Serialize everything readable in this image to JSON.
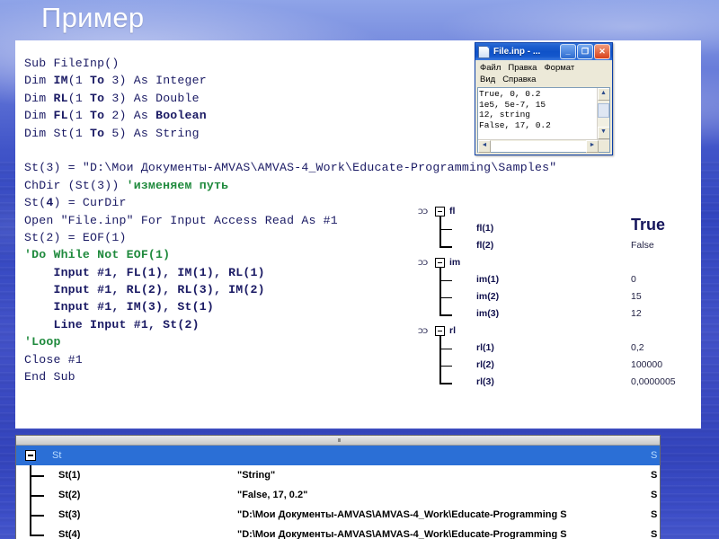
{
  "slide": {
    "title": "Пример"
  },
  "code": {
    "lines": [
      [
        {
          "t": "Sub ",
          "b": false
        },
        {
          "t": "FileInp",
          "b": false
        },
        {
          "t": "()",
          "b": false
        }
      ],
      [
        {
          "t": "Dim ",
          "b": false
        },
        {
          "t": "IM",
          "b": true
        },
        {
          "t": "(1 ",
          "b": false
        },
        {
          "t": "To",
          "b": true
        },
        {
          "t": " 3) As ",
          "b": false
        },
        {
          "t": "Integer",
          "b": false
        }
      ],
      [
        {
          "t": "Dim ",
          "b": false
        },
        {
          "t": "RL",
          "b": true
        },
        {
          "t": "(1 ",
          "b": false
        },
        {
          "t": "To",
          "b": true
        },
        {
          "t": " 3) As ",
          "b": false
        },
        {
          "t": "Double",
          "b": false
        }
      ],
      [
        {
          "t": "Dim ",
          "b": false
        },
        {
          "t": "FL",
          "b": true
        },
        {
          "t": "(1 ",
          "b": false
        },
        {
          "t": "To",
          "b": true
        },
        {
          "t": " 2) As ",
          "b": false
        },
        {
          "t": "Boolean",
          "b": true
        }
      ],
      [
        {
          "t": "Dim ",
          "b": false
        },
        {
          "t": "St",
          "b": false
        },
        {
          "t": "(1 ",
          "b": false
        },
        {
          "t": "To",
          "b": true
        },
        {
          "t": " 5) As ",
          "b": false
        },
        {
          "t": "String",
          "b": false
        }
      ],
      [],
      [
        {
          "t": "St(3) = \"D:\\Мои Документы-AMVAS\\AMVAS-4_Work\\Educate-Programming\\Samples\"",
          "b": false
        }
      ],
      [
        {
          "t": "ChDir (St(3)) ",
          "b": false
        },
        {
          "t": "'изменяем путь",
          "c": true
        }
      ],
      [
        {
          "t": "St(",
          "b": false
        },
        {
          "t": "4",
          "b": true
        },
        {
          "t": ") = CurDir",
          "b": false
        }
      ],
      [
        {
          "t": "Open \"File.inp\" For Input Access Read As #1",
          "b": false
        }
      ],
      [
        {
          "t": "St(2) = EOF(1)",
          "b": false
        }
      ],
      [
        {
          "t": "'Do While Not EOF(1)",
          "c": true
        }
      ],
      [
        {
          "t": "    Input #1, FL(1), IM(1), RL(1)",
          "b": true
        }
      ],
      [
        {
          "t": "    Input #1, RL(2), RL(3), IM(2)",
          "b": true
        }
      ],
      [
        {
          "t": "    Input #1, IM(3), St(1)",
          "b": true
        }
      ],
      [
        {
          "t": "    Line Input #1, St(2)",
          "b": true
        }
      ],
      [
        {
          "t": "'Loop",
          "c": true
        }
      ],
      [
        {
          "t": "Close #1",
          "b": false
        }
      ],
      [
        {
          "t": "End Sub",
          "b": false
        }
      ]
    ]
  },
  "notepad": {
    "title": "File.inp - ...",
    "minimize_label": "_",
    "maximize_label": "❐",
    "close_label": "✕",
    "menus_row1": [
      "Файл",
      "Правка",
      "Формат"
    ],
    "menus_row2": [
      "Вид",
      "Справка"
    ],
    "content": "True, 0, 0.2\n1e5, 5e-7, 15\n12, string\nFalse, 17, 0.2",
    "scroll_up": "▲",
    "scroll_down": "▼",
    "scroll_left": "◄",
    "scroll_right": "►"
  },
  "watch": {
    "groups": [
      {
        "icon": "glasses-icon",
        "name": "fl",
        "children": [
          {
            "name": "fl(1)",
            "value": "True",
            "style": "big"
          },
          {
            "name": "fl(2)",
            "value": "False",
            "style": "plain"
          }
        ]
      },
      {
        "icon": "glasses-icon",
        "name": "im",
        "children": [
          {
            "name": "im(1)",
            "value": "0",
            "style": "plain"
          },
          {
            "name": "im(2)",
            "value": "15",
            "style": "plain"
          },
          {
            "name": "im(3)",
            "value": "12",
            "style": "plain"
          }
        ]
      },
      {
        "icon": "glasses-icon",
        "name": "rl",
        "children": [
          {
            "name": "rl(1)",
            "value": "0,2",
            "style": "plain"
          },
          {
            "name": "rl(2)",
            "value": "100000",
            "style": "plain"
          },
          {
            "name": "rl(3)",
            "value": "0,0000005",
            "style": "plain"
          }
        ]
      }
    ]
  },
  "st_panel": {
    "root": {
      "name": "St",
      "type": "S"
    },
    "rows": [
      {
        "name": "St(1)",
        "value": "\"String\"",
        "type": "S"
      },
      {
        "name": "St(2)",
        "value": "\"False, 17, 0.2\"",
        "type": "S"
      },
      {
        "name": "St(3)",
        "value": "\"D:\\Мои Документы-AMVAS\\AMVAS-4_Work\\Educate-Programming S",
        "type": "S"
      },
      {
        "name": "St(4)",
        "value": "\"D:\\Мои Документы-AMVAS\\AMVAS-4_Work\\Educate-Programming S",
        "type": "S"
      }
    ]
  },
  "colors": {
    "code_text": "#1a1a64",
    "comment_green": "#1f8a3d",
    "title_white": "#ffffff",
    "selection_blue": "#2b6fd6",
    "background_blue": "#3a4cc4"
  }
}
